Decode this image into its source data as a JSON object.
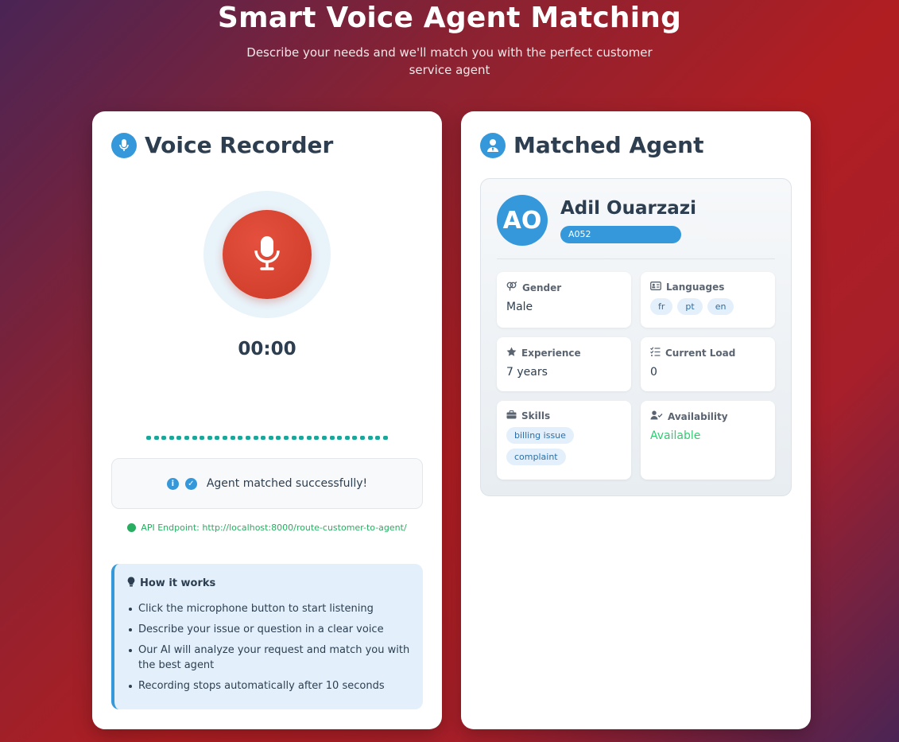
{
  "header": {
    "title": "Smart Voice Agent Matching",
    "subtitle": "Describe your needs and we'll match you with the perfect customer service agent"
  },
  "recorder": {
    "title": "Voice Recorder",
    "title_icon": "microphone-icon",
    "mic_icon": "microphone-icon",
    "timer": "00:00",
    "status_text": "Agent matched successfully!",
    "status_icons": [
      "info-icon",
      "check-circle-icon"
    ],
    "api_endpoint": "API Endpoint: http://localhost:8000/route-customer-to-agent/",
    "how_it_works": {
      "title": "How it works",
      "icon": "lightbulb-icon",
      "items": [
        "Click the microphone button to start listening",
        "Describe your issue or question in a clear voice",
        "Our AI will analyze your request and match you with the best agent",
        "Recording stops automatically after 10 seconds"
      ]
    }
  },
  "agent": {
    "title": "Matched Agent",
    "title_icon": "user-tie-icon",
    "initials": "AO",
    "name": "Adil Ouarzazi",
    "id": "A052",
    "gender": {
      "label": "Gender",
      "value": "Male",
      "icon": "gender-icon"
    },
    "languages": {
      "label": "Languages",
      "values": [
        "fr",
        "pt",
        "en"
      ],
      "icon": "id-card-icon"
    },
    "experience": {
      "label": "Experience",
      "value": "7 years",
      "icon": "star-icon"
    },
    "current_load": {
      "label": "Current Load",
      "value": "0",
      "icon": "list-check-icon"
    },
    "skills": {
      "label": "Skills",
      "values": [
        "billing issue",
        "complaint"
      ],
      "icon": "briefcase-icon"
    },
    "availability": {
      "label": "Availability",
      "value": "Available",
      "icon": "user-check-icon"
    }
  },
  "colors": {
    "accent": "#3498db",
    "record": "#d9432f",
    "success": "#27ae60",
    "available": "#2ecc71"
  }
}
